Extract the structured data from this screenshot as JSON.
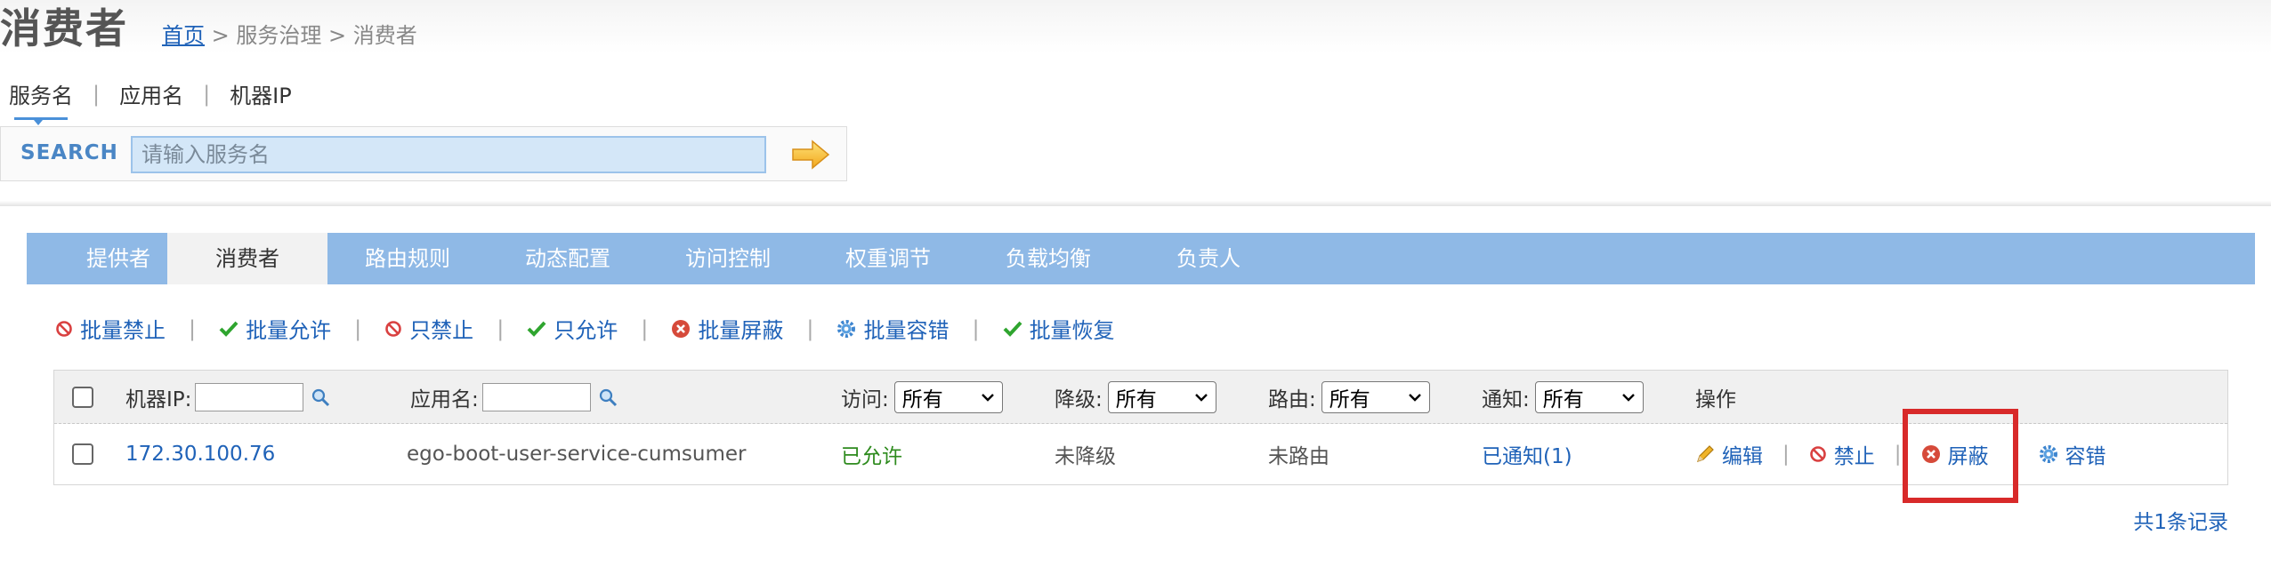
{
  "page": {
    "title": "消费者",
    "breadcrumb": {
      "home": "首页",
      "rest": " > 服务治理 > 消费者"
    }
  },
  "search": {
    "tabs": [
      "服务名",
      "应用名",
      "机器IP"
    ],
    "label": "SEARCH",
    "placeholder": "请输入服务名"
  },
  "nav": {
    "tabs": [
      "提供者",
      "消费者",
      "路由规则",
      "动态配置",
      "访问控制",
      "权重调节",
      "负载均衡",
      "负责人"
    ],
    "active": "消费者"
  },
  "batch_actions": [
    {
      "label": "批量禁止",
      "icon": "forbid-icon"
    },
    {
      "label": "批量允许",
      "icon": "check-icon"
    },
    {
      "label": "只禁止",
      "icon": "forbid-icon"
    },
    {
      "label": "只允许",
      "icon": "check-icon"
    },
    {
      "label": "批量屏蔽",
      "icon": "close-circle-icon"
    },
    {
      "label": "批量容错",
      "icon": "gear-icon"
    },
    {
      "label": "批量恢复",
      "icon": "check-icon"
    }
  ],
  "table": {
    "headers": {
      "ip": "机器IP:",
      "app": "应用名:",
      "access": "访问:",
      "degrade": "降级:",
      "route": "路由:",
      "notify": "通知:",
      "ops": "操作"
    },
    "filter_default": "所有",
    "rows": [
      {
        "ip": "172.30.100.76",
        "app": "ego-boot-user-service-cumsumer",
        "access": "已允许",
        "degrade": "未降级",
        "route": "未路由",
        "notify": "已通知(1)",
        "ops": {
          "edit": "编辑",
          "forbid": "禁止",
          "shield": "屏蔽",
          "tolerate": "容错"
        }
      }
    ],
    "total": "共1条记录"
  },
  "colors": {
    "link": "#1f62b8",
    "nav_bg": "#8fb9e6",
    "allowed": "#2e8b1e",
    "highlight": "#d82a2a"
  }
}
